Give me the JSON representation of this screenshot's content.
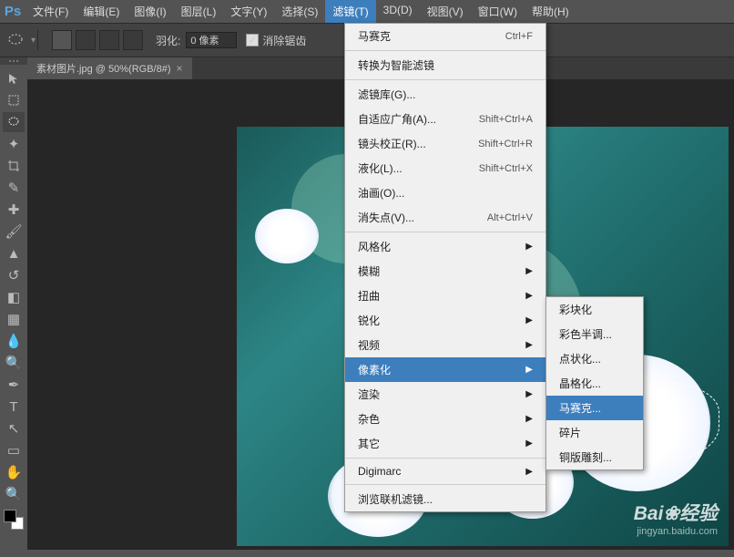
{
  "app": {
    "logo": "Ps"
  },
  "menubar": [
    {
      "label": "文件(F)"
    },
    {
      "label": "编辑(E)"
    },
    {
      "label": "图像(I)"
    },
    {
      "label": "图层(L)"
    },
    {
      "label": "文字(Y)"
    },
    {
      "label": "选择(S)"
    },
    {
      "label": "滤镜(T)",
      "active": true
    },
    {
      "label": "3D(D)"
    },
    {
      "label": "视图(V)"
    },
    {
      "label": "窗口(W)"
    },
    {
      "label": "帮助(H)"
    }
  ],
  "options": {
    "feather_label": "羽化:",
    "feather_value": "0 像素",
    "antialias_label": "消除锯齿",
    "checked": "✓"
  },
  "document": {
    "tab_title": "素材图片.jpg @ 50%(RGB/8#)",
    "close": "×"
  },
  "filter_menu": [
    {
      "label": "马赛克",
      "shortcut": "Ctrl+F"
    },
    {
      "sep": true
    },
    {
      "label": "转换为智能滤镜"
    },
    {
      "sep": true
    },
    {
      "label": "滤镜库(G)..."
    },
    {
      "label": "自适应广角(A)...",
      "shortcut": "Shift+Ctrl+A"
    },
    {
      "label": "镜头校正(R)...",
      "shortcut": "Shift+Ctrl+R"
    },
    {
      "label": "液化(L)...",
      "shortcut": "Shift+Ctrl+X"
    },
    {
      "label": "油画(O)..."
    },
    {
      "label": "消失点(V)...",
      "shortcut": "Alt+Ctrl+V"
    },
    {
      "sep": true
    },
    {
      "label": "风格化",
      "arrow": true
    },
    {
      "label": "模糊",
      "arrow": true
    },
    {
      "label": "扭曲",
      "arrow": true
    },
    {
      "label": "锐化",
      "arrow": true
    },
    {
      "label": "视频",
      "arrow": true
    },
    {
      "label": "像素化",
      "arrow": true,
      "highlight": true
    },
    {
      "label": "渲染",
      "arrow": true
    },
    {
      "label": "杂色",
      "arrow": true
    },
    {
      "label": "其它",
      "arrow": true
    },
    {
      "sep": true
    },
    {
      "label": "Digimarc",
      "arrow": true
    },
    {
      "sep": true
    },
    {
      "label": "浏览联机滤镜..."
    }
  ],
  "submenu": [
    {
      "label": "彩块化"
    },
    {
      "label": "彩色半调..."
    },
    {
      "label": "点状化..."
    },
    {
      "label": "晶格化..."
    },
    {
      "label": "马赛克...",
      "highlight": true
    },
    {
      "label": "碎片"
    },
    {
      "label": "铜版雕刻..."
    }
  ],
  "watermark": {
    "main": "Bai❀经验",
    "sub": "jingyan.baidu.com"
  }
}
